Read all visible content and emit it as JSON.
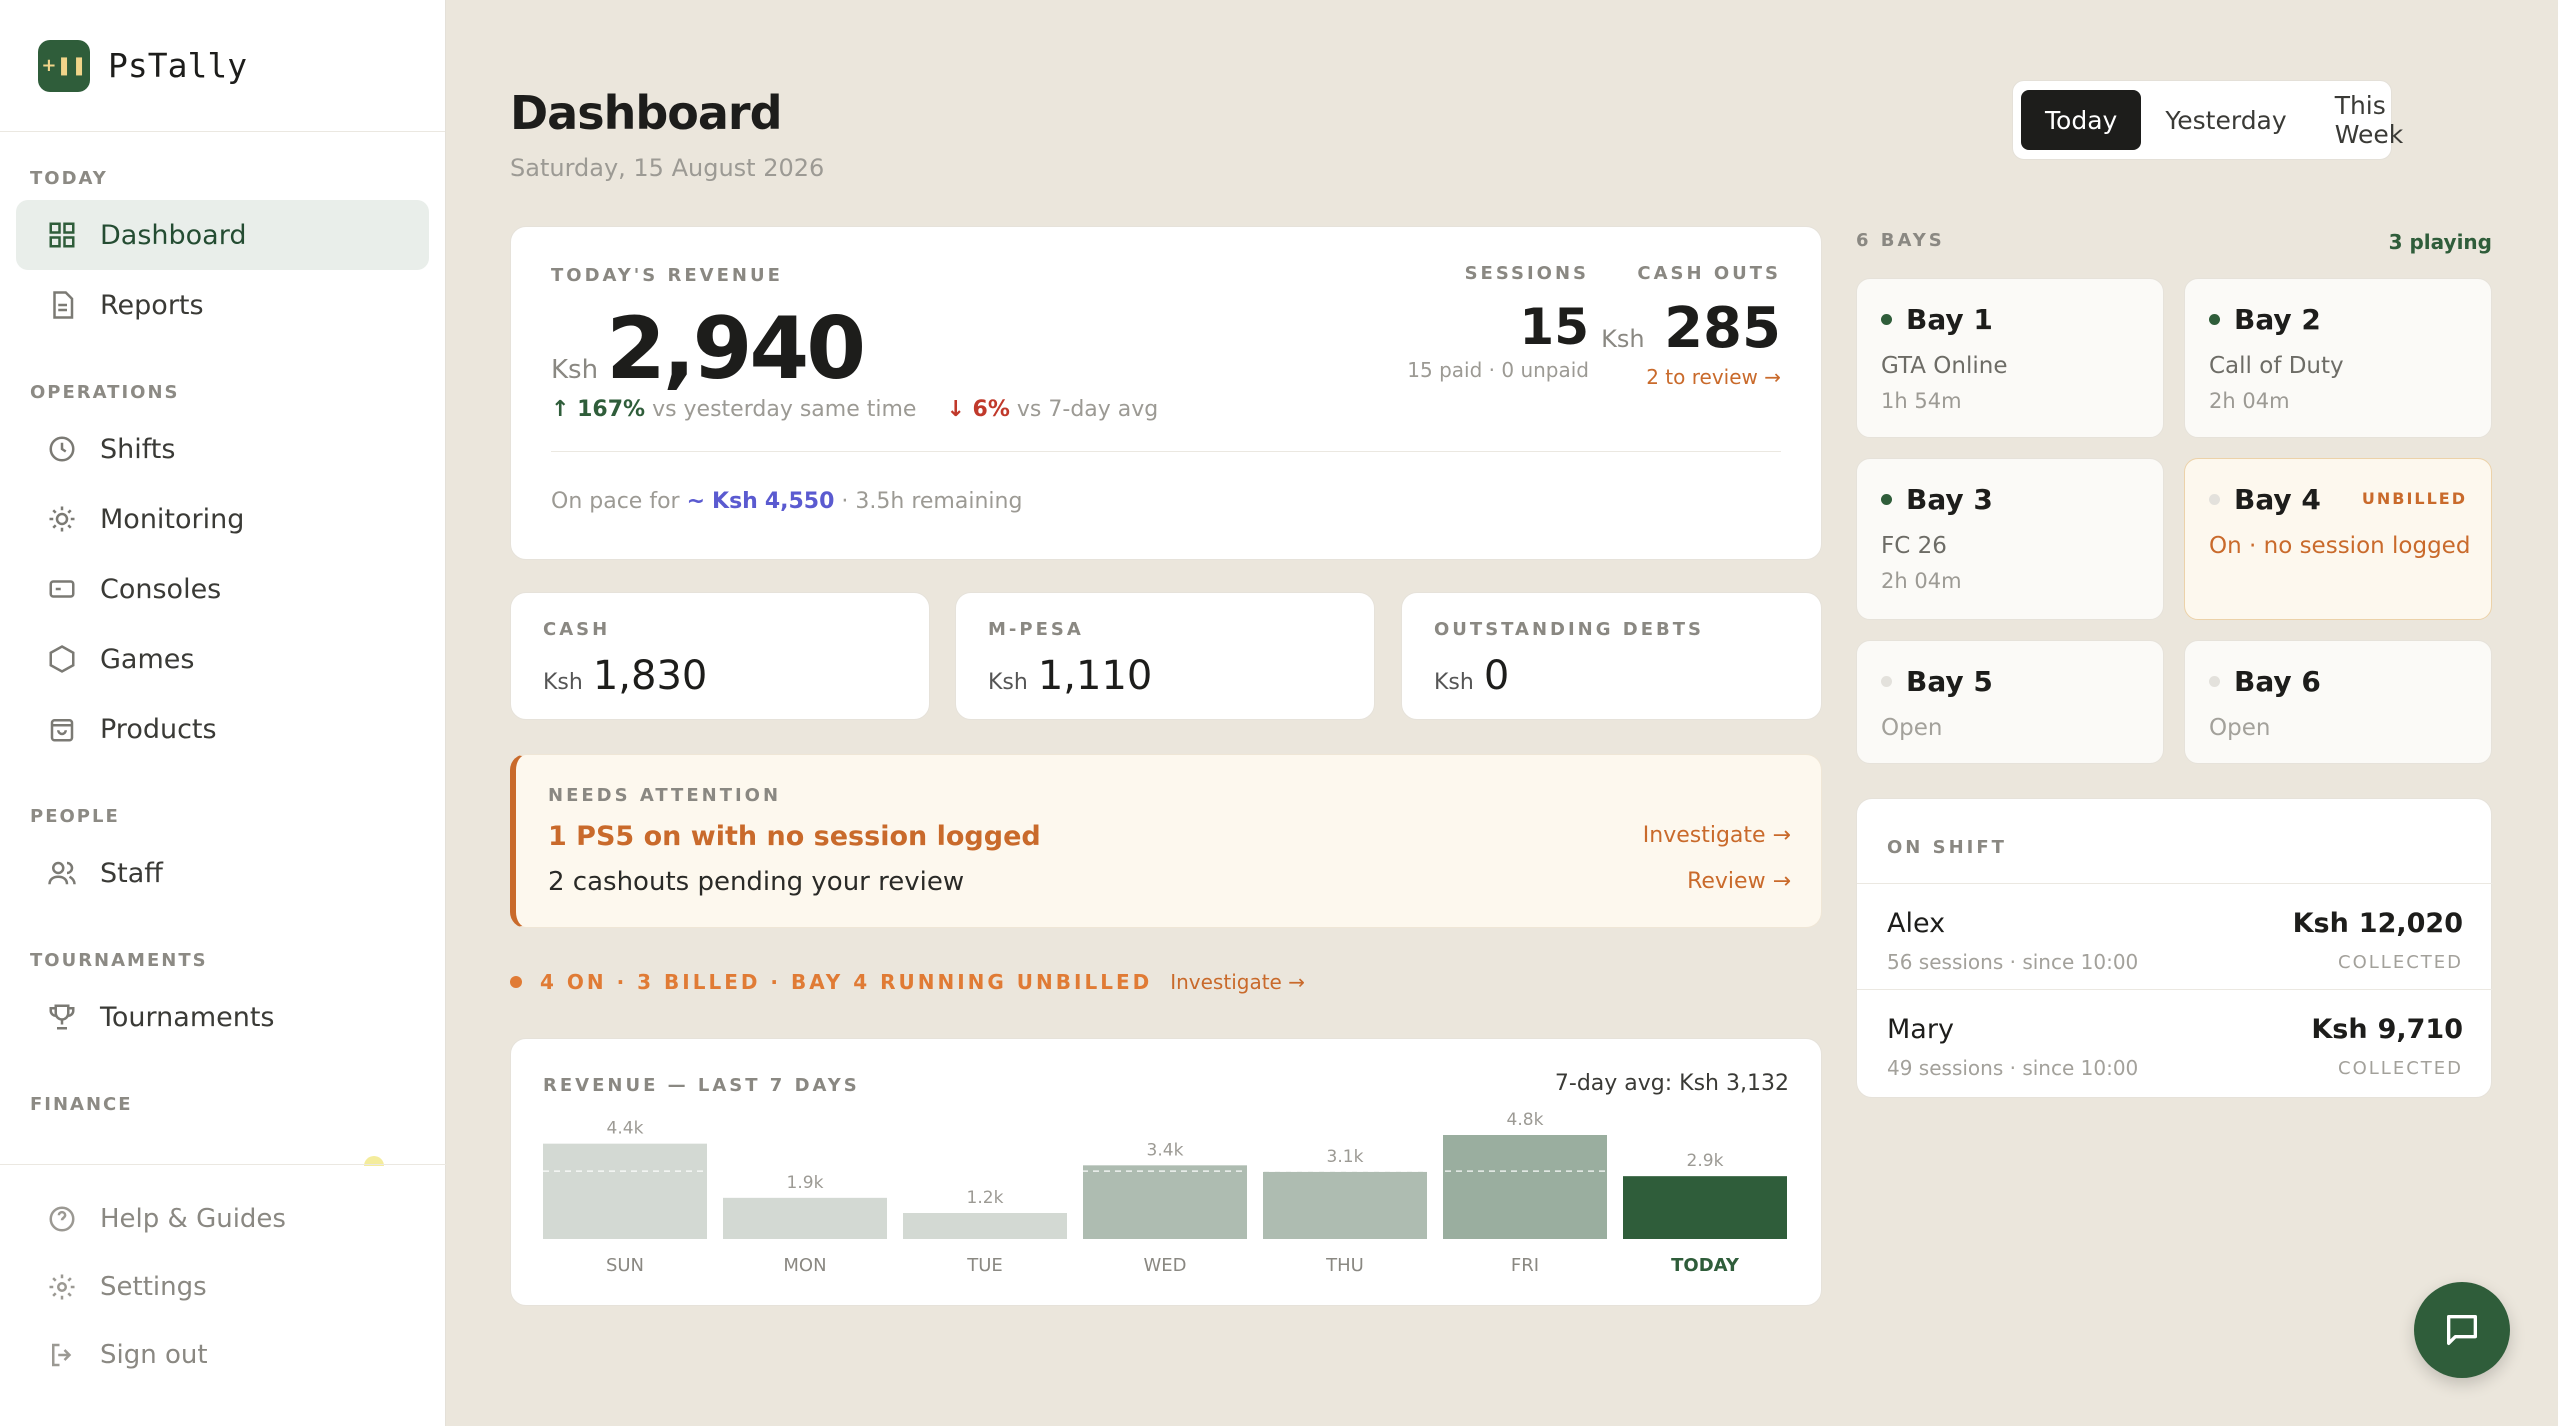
{
  "app": {
    "name": "PsTally"
  },
  "sidebar": {
    "sections": [
      {
        "heading": "TODAY",
        "items": [
          {
            "label": "Dashboard",
            "icon": "grid-icon",
            "active": true
          },
          {
            "label": "Reports",
            "icon": "document-icon"
          }
        ]
      },
      {
        "heading": "OPERATIONS",
        "items": [
          {
            "label": "Shifts",
            "icon": "clock-icon"
          },
          {
            "label": "Monitoring",
            "icon": "sun-icon"
          },
          {
            "label": "Consoles",
            "icon": "console-icon"
          },
          {
            "label": "Games",
            "icon": "hexagon-icon"
          },
          {
            "label": "Products",
            "icon": "bag-icon"
          }
        ]
      },
      {
        "heading": "PEOPLE",
        "items": [
          {
            "label": "Staff",
            "icon": "users-icon"
          }
        ]
      },
      {
        "heading": "TOURNAMENTS",
        "items": [
          {
            "label": "Tournaments",
            "icon": "trophy-icon"
          }
        ]
      },
      {
        "heading": "FINANCE",
        "items": []
      }
    ],
    "bottom": [
      {
        "label": "Help & Guides",
        "icon": "help-icon"
      },
      {
        "label": "Settings",
        "icon": "gear-icon"
      },
      {
        "label": "Sign out",
        "icon": "sign-out-icon"
      }
    ]
  },
  "header": {
    "title": "Dashboard",
    "date": "Saturday, 15 August 2026",
    "range_tabs": [
      "Today",
      "Yesterday",
      "This Week"
    ],
    "active_tab": "Today"
  },
  "revenue": {
    "label": "TODAY'S REVENUE",
    "currency": "Ksh",
    "value": "2,940",
    "vs_yesterday_pct": "167%",
    "vs_yesterday_text": "vs yesterday same time",
    "vs_avg_pct": "6%",
    "vs_avg_text": "vs 7-day avg",
    "pace_prefix": "On pace for",
    "pace_symbol": "~",
    "pace_currency": "Ksh",
    "pace_value": "4,550",
    "pace_remaining": "· 3.5h remaining",
    "sessions_label": "SESSIONS",
    "sessions_value": "15",
    "sessions_sub": "15 paid · 0 unpaid",
    "cashouts_label": "CASH OUTS",
    "cashouts_currency": "Ksh",
    "cashouts_value": "285",
    "cashouts_link": "2 to review →"
  },
  "totals": [
    {
      "label": "CASH",
      "currency": "Ksh",
      "value": "1,830"
    },
    {
      "label": "M-PESA",
      "currency": "Ksh",
      "value": "1,110"
    },
    {
      "label": "OUTSTANDING DEBTS",
      "currency": "Ksh",
      "value": "0"
    }
  ],
  "attention": {
    "label": "NEEDS ATTENTION",
    "line1": "1 PS5 on with no session logged",
    "line1_action": "Investigate →",
    "line2": "2 cashouts pending your review",
    "line2_action": "Review →"
  },
  "status_line": {
    "text": "4 ON · 3 BILLED · BAY 4 RUNNING UNBILLED",
    "action": "Investigate →"
  },
  "chart_data": {
    "type": "bar",
    "title": "REVENUE — LAST 7 DAYS",
    "avg_label": "7-day avg:",
    "avg_currency": "Ksh",
    "avg_value": "3,132",
    "avg": 3132,
    "categories": [
      "SUN",
      "MON",
      "TUE",
      "WED",
      "THU",
      "FRI",
      "TODAY"
    ],
    "values": [
      4400,
      1900,
      1200,
      3400,
      3100,
      4800,
      2900
    ],
    "labels": [
      "4.4k",
      "1.9k",
      "1.2k",
      "3.4k",
      "3.1k",
      "4.8k",
      "2.9k"
    ],
    "ylim": [
      0,
      4800
    ],
    "colors": [
      "#d3d9d3",
      "#d3d9d3",
      "#d3d9d3",
      "#aebcb1",
      "#aebcb1",
      "#9aae9f",
      "#2f5d3a"
    ]
  },
  "bays": {
    "label": "6 BAYS",
    "playing": "3 playing",
    "items": [
      {
        "name": "Bay 1",
        "status": "on",
        "game": "GTA Online",
        "time": "1h  54m"
      },
      {
        "name": "Bay 2",
        "status": "on",
        "game": "Call of Duty",
        "time": "2h  04m"
      },
      {
        "name": "Bay 3",
        "status": "on",
        "game": "FC 26",
        "time": "2h  04m"
      },
      {
        "name": "Bay 4",
        "status": "unbilled",
        "badge": "UNBILLED",
        "note": "On · no session logged"
      },
      {
        "name": "Bay 5",
        "status": "open",
        "note": "Open"
      },
      {
        "name": "Bay 6",
        "status": "open",
        "note": "Open"
      }
    ]
  },
  "on_shift": {
    "label": "ON SHIFT",
    "staff": [
      {
        "name": "Alex",
        "meta": "56 sessions · since 10:00",
        "currency": "Ksh",
        "amount": "12,020",
        "note": "COLLECTED"
      },
      {
        "name": "Mary",
        "meta": "49 sessions · since 10:00",
        "currency": "Ksh",
        "amount": "9,710",
        "note": "COLLECTED"
      }
    ]
  },
  "colors": {
    "brand": "#2f5d3a",
    "warning": "#c96a2b",
    "background": "#ebe6dc"
  }
}
